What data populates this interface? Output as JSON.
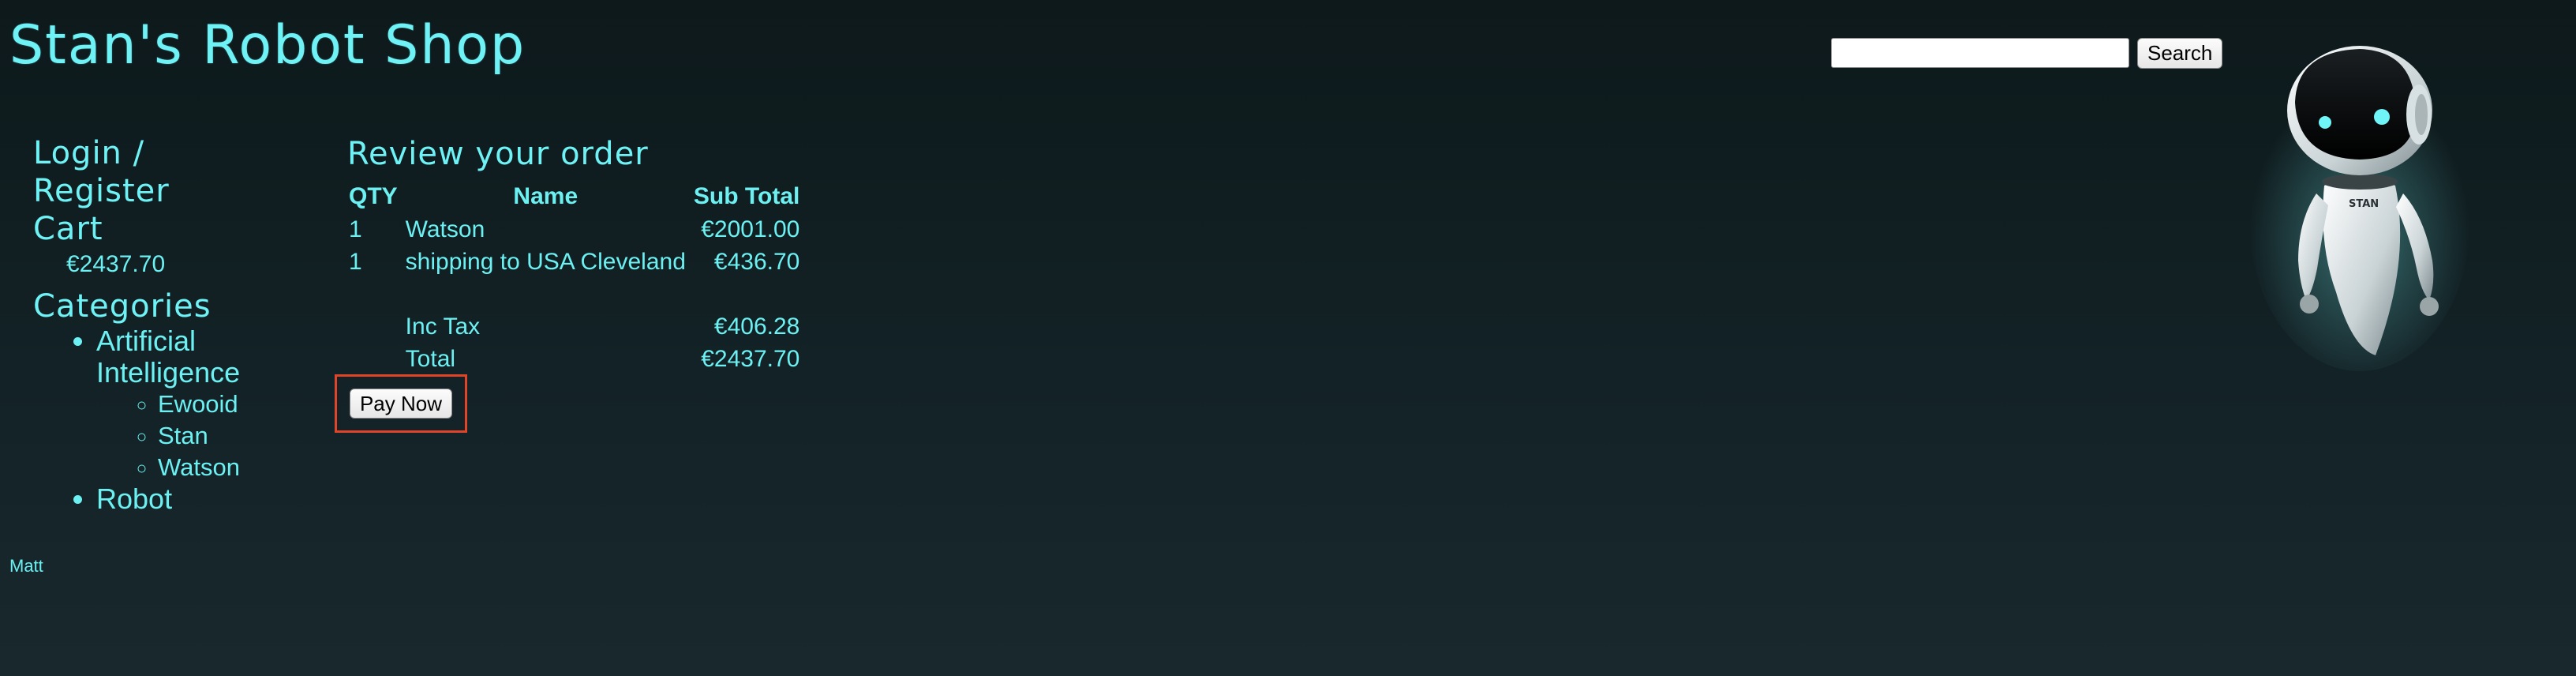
{
  "site": {
    "title": "Stan's Robot Shop"
  },
  "search": {
    "value": "",
    "button_label": "Search"
  },
  "sidebar": {
    "login_label": "Login / Register",
    "cart_label": "Cart",
    "cart_total": "€2437.70",
    "categories_label": "Categories",
    "categories": [
      {
        "label": "Artificial Intelligence",
        "items": [
          "Ewooid",
          "Stan",
          "Watson"
        ]
      },
      {
        "label": "Robot",
        "items": []
      }
    ]
  },
  "order": {
    "title": "Review your order",
    "headers": {
      "qty": "QTY",
      "name": "Name",
      "subtotal": "Sub Total"
    },
    "rows": [
      {
        "qty": "1",
        "name": "Watson",
        "subtotal": "€2001.00"
      },
      {
        "qty": "1",
        "name": "shipping to USA Cleveland",
        "subtotal": "€436.70"
      }
    ],
    "tax_label": "Inc Tax",
    "tax_value": "€406.28",
    "total_label": "Total",
    "total_value": "€2437.70",
    "pay_button": "Pay Now"
  },
  "footer": {
    "text": "Matt"
  },
  "mascot": {
    "badge": "STAN"
  },
  "colors": {
    "accent": "#6ef2f5",
    "background": "#111d20",
    "highlight": "#e0452a"
  }
}
